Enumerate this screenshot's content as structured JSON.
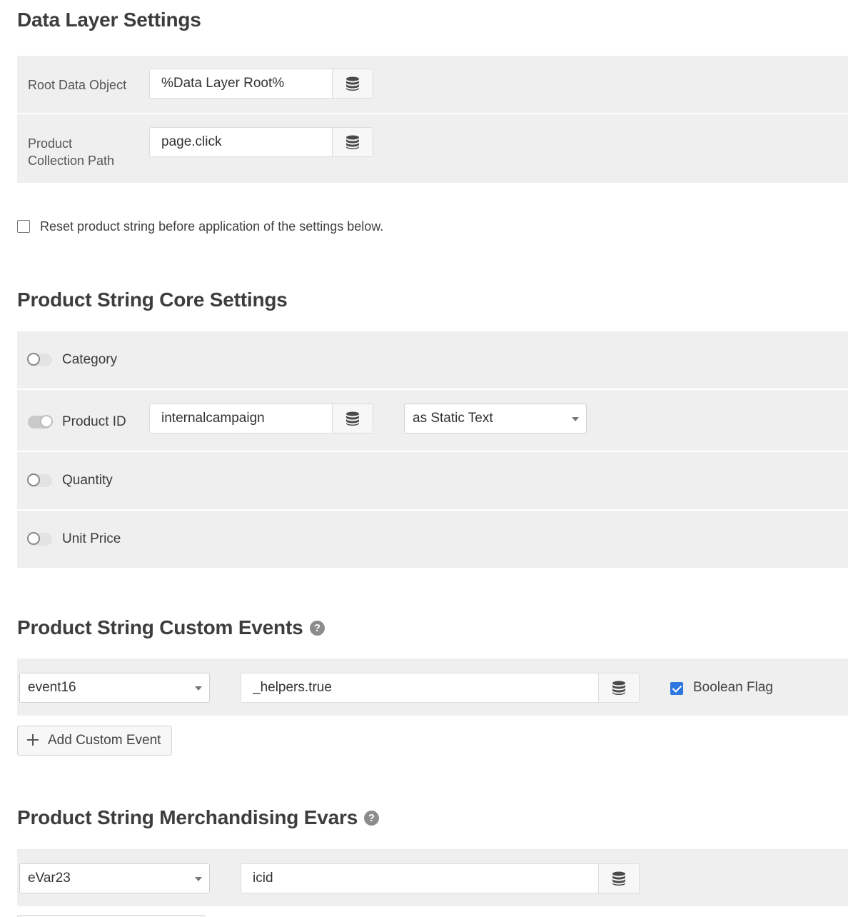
{
  "data_layer": {
    "title": "Data Layer Settings",
    "root_label": "Root Data Object",
    "root_value": "%Data Layer Root%",
    "path_label_line1": "Product",
    "path_label_line2": "Collection Path",
    "path_value": "page.click"
  },
  "reset": {
    "label": "Reset product string before application of the settings below.",
    "checked": false
  },
  "core": {
    "title": "Product String Core Settings",
    "category_label": "Category",
    "category_on": false,
    "product_id_label": "Product ID",
    "product_id_on": true,
    "product_id_value": "internalcampaign",
    "product_id_mode": "as Static Text",
    "quantity_label": "Quantity",
    "quantity_on": false,
    "unit_price_label": "Unit Price",
    "unit_price_on": false
  },
  "events": {
    "title": "Product String Custom Events",
    "help_glyph": "?",
    "event_select": "event16",
    "event_value": "_helpers.true",
    "boolean_label": "Boolean Flag",
    "boolean_checked": true,
    "add_label": "Add Custom Event"
  },
  "evars": {
    "title": "Product String Merchandising Evars",
    "help_glyph": "?",
    "evar_select": "eVar23",
    "evar_value": "icid"
  },
  "icons": {
    "db": "database-icon",
    "help": "question-circle-icon",
    "plus": "plus-icon",
    "caret": "caret-down-icon"
  }
}
